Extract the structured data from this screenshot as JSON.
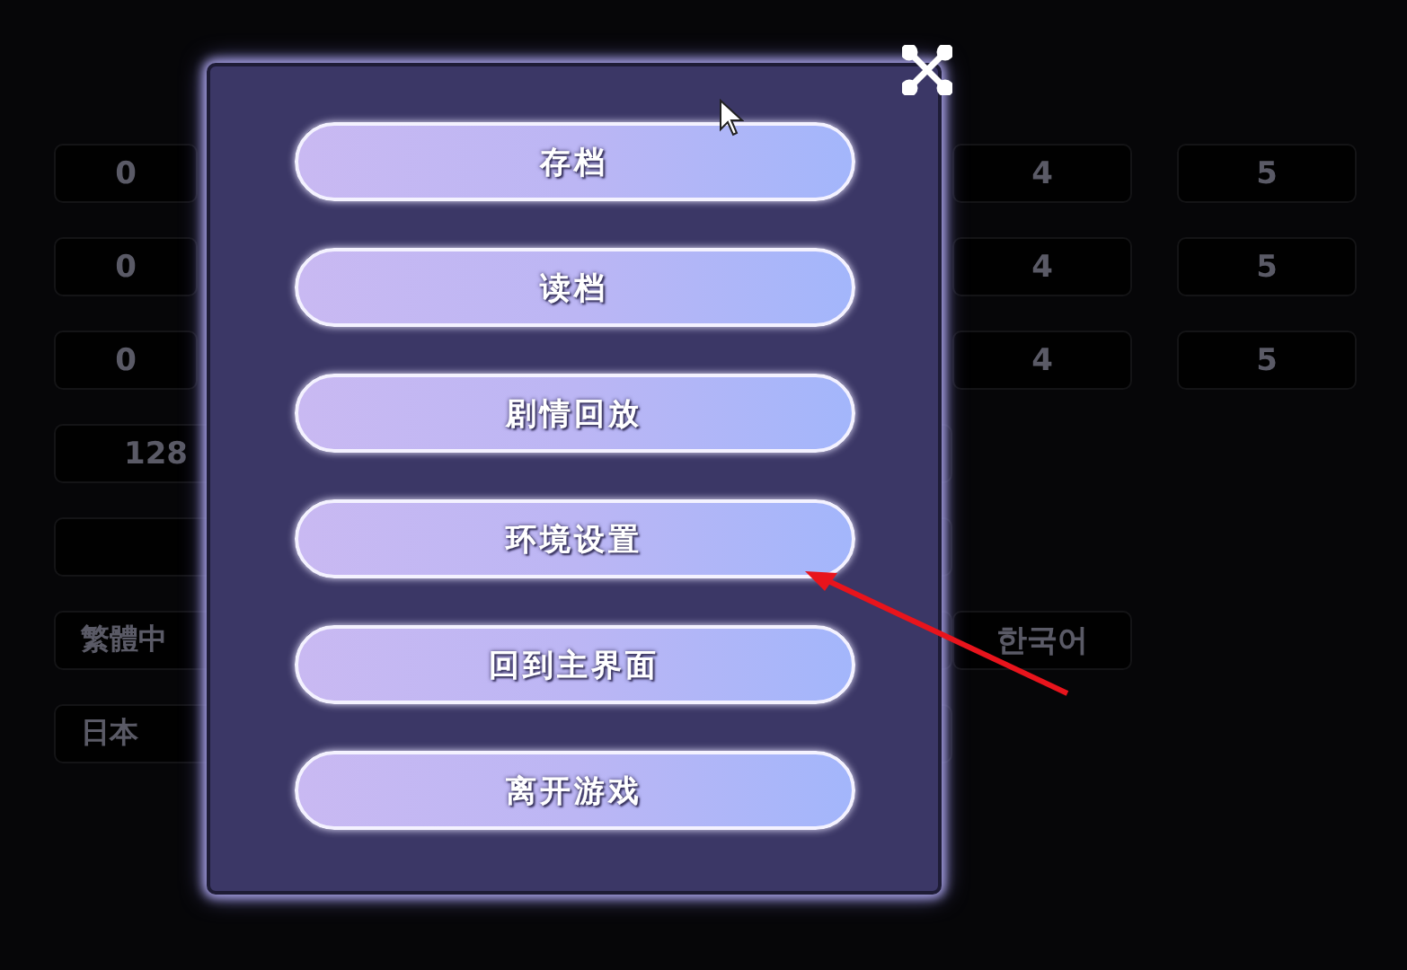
{
  "background": {
    "slot_rows": [
      {
        "cells": [
          "0",
          "4",
          "5"
        ]
      },
      {
        "cells": [
          "0",
          "4",
          "5"
        ]
      },
      {
        "cells": [
          "0",
          "4",
          "5"
        ]
      }
    ],
    "resolution": "128",
    "languages_left": [
      "繁體中",
      "日本"
    ],
    "languages_right": [
      "한국어"
    ]
  },
  "menu": {
    "items": [
      {
        "label": "存档"
      },
      {
        "label": "读档"
      },
      {
        "label": "剧情回放"
      },
      {
        "label": "环境设置"
      },
      {
        "label": "回到主界面"
      },
      {
        "label": "离开游戏"
      }
    ]
  }
}
